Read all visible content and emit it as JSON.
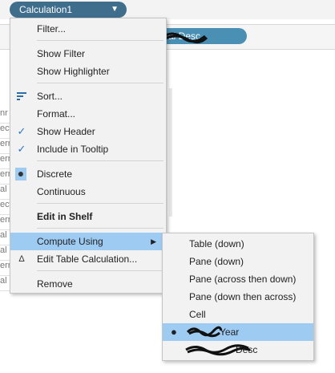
{
  "shelf": {
    "calc_pill_label": "Calculation1",
    "calc_pill_caret": "▼",
    "row2_pill_label": "al Desc"
  },
  "background_rows": [
    "nr",
    "ect",
    "err",
    "err",
    "err",
    "al",
    "ect",
    "err",
    "al",
    "al",
    "err",
    "al"
  ],
  "menu": {
    "items": {
      "filter": "Filter...",
      "show_filter": "Show Filter",
      "show_highlighter": "Show Highlighter",
      "sort": "Sort...",
      "format": "Format...",
      "show_header": "Show Header",
      "include_tooltip": "Include in Tooltip",
      "discrete": "Discrete",
      "continuous": "Continuous",
      "edit_in_shelf": "Edit in Shelf",
      "compute_using": "Compute Using",
      "edit_table_calc": "Edit Table Calculation...",
      "remove": "Remove"
    },
    "check_glyph": "✓",
    "bullet_glyph": "●",
    "delta_glyph": "Δ",
    "submenu_arrow": "▶"
  },
  "submenu": {
    "items": {
      "table_down": "Table (down)",
      "pane_down": "Pane (down)",
      "pane_across_then_down": "Pane (across then down)",
      "pane_down_then_across": "Pane (down then across)",
      "cell": "Cell",
      "year": "Year",
      "desc": "Desc"
    },
    "selected": "year"
  },
  "colors": {
    "pill_dark": "#3f6e8c",
    "pill_light": "#4a90b4",
    "menu_bg": "#f2f2f2",
    "highlight": "#9dcbf2",
    "check": "#2a78c6"
  }
}
